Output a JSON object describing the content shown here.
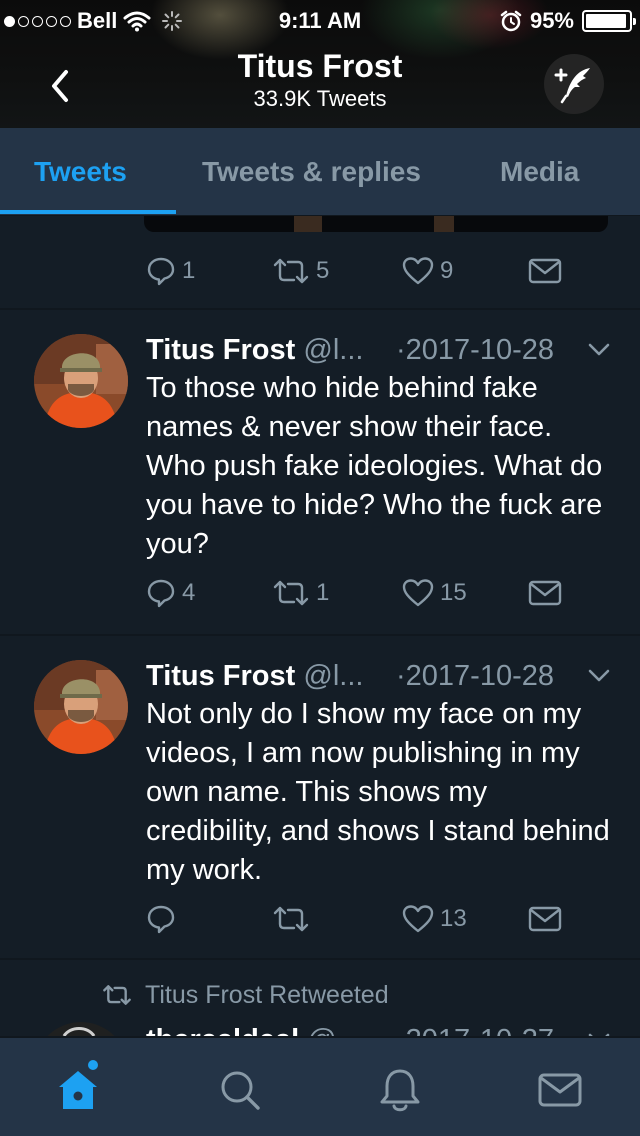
{
  "status_bar": {
    "carrier": "Bell",
    "time": "9:11 AM",
    "battery_percent": "95%",
    "battery_level": 0.95,
    "signal_bars_filled": 1,
    "signal_bars_total": 5
  },
  "header": {
    "title": "Titus Frost",
    "subtitle": "33.9K Tweets",
    "back_icon": "chevron-left-icon",
    "compose_icon": "compose-quill-icon"
  },
  "tabs": [
    {
      "label": "Tweets",
      "active": true
    },
    {
      "label": "Tweets & replies",
      "active": false
    },
    {
      "label": "Media",
      "active": false
    }
  ],
  "feed": {
    "first_tweet_actions": {
      "replies": "1",
      "retweets": "5",
      "likes": "9"
    },
    "tweets": [
      {
        "name": "Titus Frost",
        "handle": "@l...",
        "date": "·2017-10-28",
        "text": "To those who hide behind fake names & never show their face. Who push fake ideologies. What do you have to hide? Who the fuck are you?",
        "replies": "4",
        "retweets": "1",
        "likes": "15"
      },
      {
        "name": "Titus Frost",
        "handle": "@l...",
        "date": "·2017-10-28",
        "text": "Not only do I show my face on my videos, I am now publishing in my own name. This shows my credibility, and shows I stand behind my work.",
        "replies": "",
        "retweets": "",
        "likes": "13"
      }
    ],
    "retweet_context": "Titus Frost Retweeted",
    "partial_tweet": {
      "name": "therealdeal",
      "handle": "@...",
      "date": "·2017-10-27"
    }
  },
  "bottom_nav": [
    {
      "icon": "home-icon",
      "active": true
    },
    {
      "icon": "search-icon",
      "active": false
    },
    {
      "icon": "bell-icon",
      "active": false
    },
    {
      "icon": "mail-icon",
      "active": false
    }
  ],
  "colors": {
    "background": "#141d26",
    "bar": "#243447",
    "accent": "#1da1f2",
    "muted": "#8899a6"
  }
}
